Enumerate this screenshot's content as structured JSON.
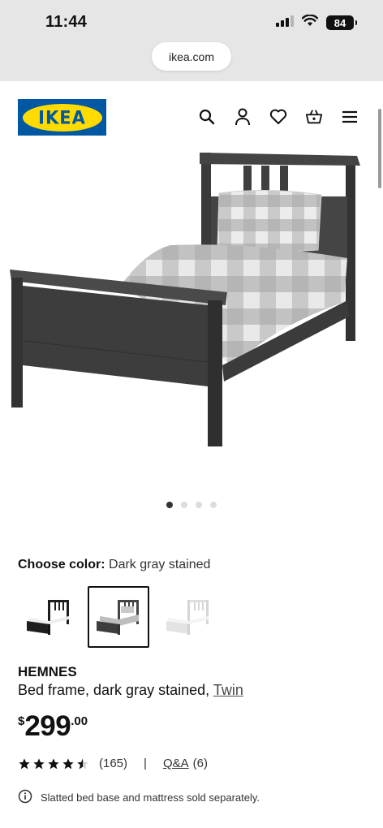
{
  "status_bar": {
    "time": "11:44",
    "battery": "84"
  },
  "browser": {
    "url": "ikea.com"
  },
  "header": {
    "logo_text": "IKEA",
    "icons": [
      "search-icon",
      "account-icon",
      "heart-icon",
      "basket-icon",
      "menu-icon"
    ]
  },
  "gallery": {
    "page_count": 4,
    "active_index": 0
  },
  "color": {
    "label": "Choose color:",
    "selected": "Dark gray stained",
    "options": [
      "black-brown",
      "dark gray stained",
      "white stain"
    ]
  },
  "product": {
    "name": "HEMNES",
    "description": "Bed frame, dark gray stained,",
    "size_link": "Twin",
    "price": {
      "currency": "$",
      "integer": "299",
      "decimal": ".00"
    },
    "rating": {
      "stars": 4.5,
      "count": "(165)",
      "qa_label": "Q&A",
      "qa_count": "(6)"
    },
    "notice": "Slatted bed base and mattress sold separately."
  },
  "colors": {
    "ikea_blue": "#0058a3",
    "ikea_yellow": "#ffdb00",
    "chrome_gray": "#e6e6e6"
  }
}
